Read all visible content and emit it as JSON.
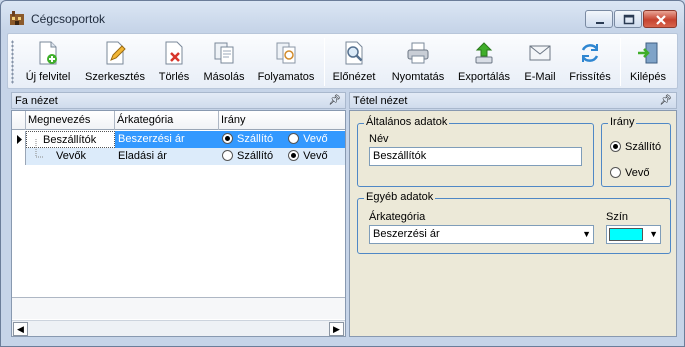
{
  "window": {
    "title": "Cégcsoportok"
  },
  "toolbar": {
    "new": "Új felvitel",
    "edit": "Szerkesztés",
    "delete": "Törlés",
    "copy": "Másolás",
    "ongoing": "Folyamatos",
    "preview": "Előnézet",
    "print": "Nyomtatás",
    "export": "Exportálás",
    "email": "E-Mail",
    "refresh": "Frissítés",
    "exit": "Kilépés"
  },
  "tree_view": {
    "title": "Fa nézet",
    "columns": [
      "Megnevezés",
      "Árkategória",
      "Irány"
    ],
    "direction_options": [
      "Szállító",
      "Vevő"
    ],
    "rows": [
      {
        "name": "Beszállítók",
        "price_category": "Beszerzési ár",
        "direction": "Szállító",
        "selected": true
      },
      {
        "name": "Vevők",
        "price_category": "Eladási ár",
        "direction": "Vevő",
        "selected": false
      }
    ]
  },
  "item_view": {
    "title": "Tétel nézet",
    "general_group": "Általános adatok",
    "name_label": "Név",
    "name_value": "Beszállítók",
    "direction_group": "Irány",
    "direction_options": [
      "Szállító",
      "Vevő"
    ],
    "direction_selected": "Szállító",
    "other_group": "Egyéb adatok",
    "price_category_label": "Árkategória",
    "price_category_value": "Beszerzési ár",
    "color_label": "Szín",
    "color_value": "#00ffff"
  },
  "colors": {
    "selection": "#3399ff",
    "accent": "#4f88c6"
  }
}
